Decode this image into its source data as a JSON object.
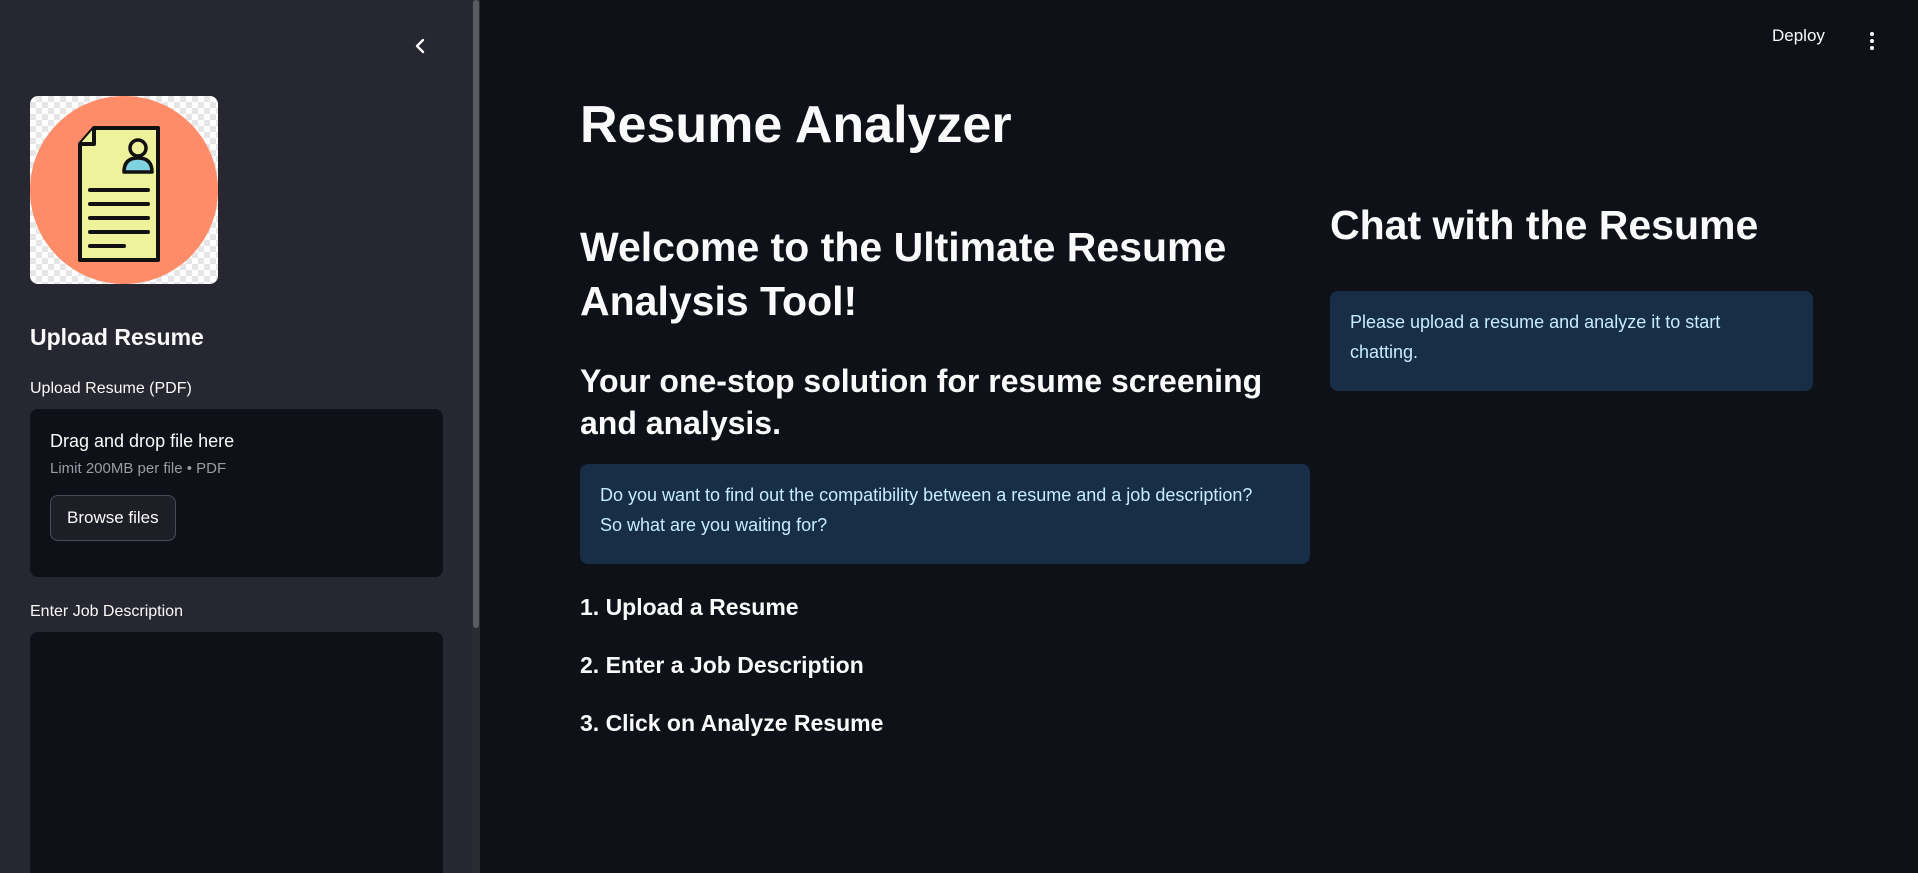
{
  "sidebar": {
    "collapse_icon": "chevron-left-icon",
    "logo_icon": "resume-document-icon",
    "upload_heading": "Upload Resume",
    "upload_label": "Upload Resume (PDF)",
    "dropzone": {
      "title": "Drag and drop file here",
      "limit": "Limit 200MB per file • PDF",
      "browse_label": "Browse files"
    },
    "job_description_label": "Enter Job Description",
    "job_description_value": ""
  },
  "toolbar": {
    "deploy_label": "Deploy",
    "menu_icon": "kebab-menu-icon"
  },
  "main": {
    "title": "Resume Analyzer",
    "welcome": "Welcome to the Ultimate Resume Analysis Tool!",
    "subheading": "Your one-stop solution for resume screening and analysis.",
    "info_line1": "Do you want to find out the compatibility between a resume and a job description?",
    "info_line2": "So what are you waiting for?",
    "steps": [
      "1. Upload a Resume",
      "2. Enter a Job Description",
      "3. Click on Analyze Resume"
    ]
  },
  "chat": {
    "title": "Chat with the Resume",
    "info_line1": "Please upload a resume and analyze it to start",
    "info_line2": "chatting."
  },
  "colors": {
    "app_background": "#0e1117",
    "sidebar_background": "#262730",
    "info_background": "#172d48",
    "info_text": "#c7ebff",
    "logo_circle": "#ff8c69",
    "logo_paper": "#eef29a"
  }
}
